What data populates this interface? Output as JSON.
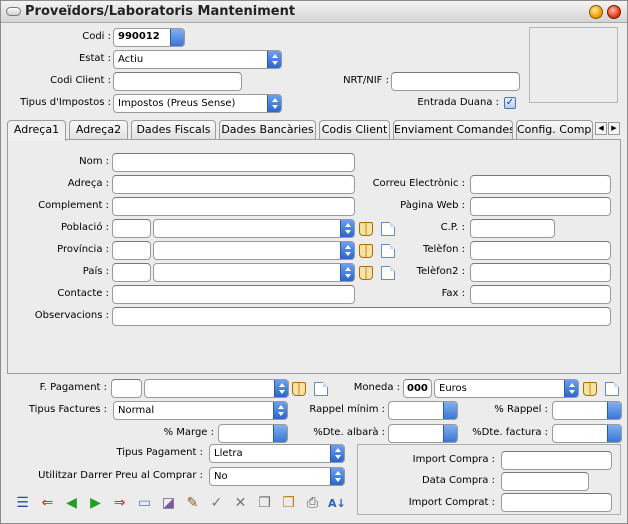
{
  "window": {
    "title": "Proveïdors/Laboratoris Manteniment"
  },
  "header": {
    "codi_label": "Codi :",
    "codi_value": "990012",
    "estat_label": "Estat :",
    "estat_value": "Actiu",
    "codi_client_label": "Codi Client :",
    "codi_client_value": "",
    "nrt_label": "NRT/NIF :",
    "nrt_value": "",
    "tipus_impostos_label": "Tipus d'Impostos :",
    "tipus_impostos_value": "Impostos (Preus Sense)",
    "entrada_duana_label": "Entrada Duana :",
    "entrada_duana_checked": true
  },
  "tabs": [
    {
      "label": "Adreça1",
      "active": true
    },
    {
      "label": "Adreça2",
      "active": false
    },
    {
      "label": "Dades Fiscals",
      "active": false
    },
    {
      "label": "Dades Bancàries",
      "active": false
    },
    {
      "label": "Codis Client",
      "active": false
    },
    {
      "label": "Enviament Comandes",
      "active": false
    },
    {
      "label": "Config. Compres",
      "active": false
    }
  ],
  "address": {
    "nom_label": "Nom :",
    "adreca_label": "Adreça :",
    "complement_label": "Complement :",
    "poblacio_label": "Població :",
    "provincia_label": "Província :",
    "pais_label": "País :",
    "contacte_label": "Contacte :",
    "observacions_label": "Observacions :",
    "correu_label": "Correu Electrònic :",
    "web_label": "Pàgina Web :",
    "cp_label": "C.P. :",
    "telefon_label": "Telèfon :",
    "telefon2_label": "Telèfon2 :",
    "fax_label": "Fax :"
  },
  "payment": {
    "f_pagament_label": "F. Pagament :",
    "moneda_label": "Moneda :",
    "moneda_code": "000",
    "moneda_name": "Euros",
    "tipus_factures_label": "Tipus Factures :",
    "tipus_factures_value": "Normal",
    "rappel_minim_label": "Rappel mínim :",
    "rappel_label": "% Rappel :",
    "marge_label": "% Marge :",
    "dte_albara_label": "%Dte. albarà :",
    "dte_factura_label": "%Dte. factura :",
    "tipus_pagament_label": "Tipus Pagament :",
    "tipus_pagament_value": "Lletra",
    "darrer_preu_label": "Utilitzar Darrer Preu al Comprar :",
    "darrer_preu_value": "No",
    "import_compra_label": "Import Compra :",
    "data_compra_label": "Data Compra :",
    "import_comprat_label": "Import Comprat :"
  },
  "toolbar": {
    "icons": [
      "list-icon",
      "back-icon",
      "prev-icon",
      "next-icon",
      "forward-icon",
      "new-icon",
      "erase-icon",
      "edit-icon",
      "accept-icon",
      "delete-icon",
      "copy-icon",
      "search-icon",
      "print-icon",
      "sort-icon"
    ]
  }
}
